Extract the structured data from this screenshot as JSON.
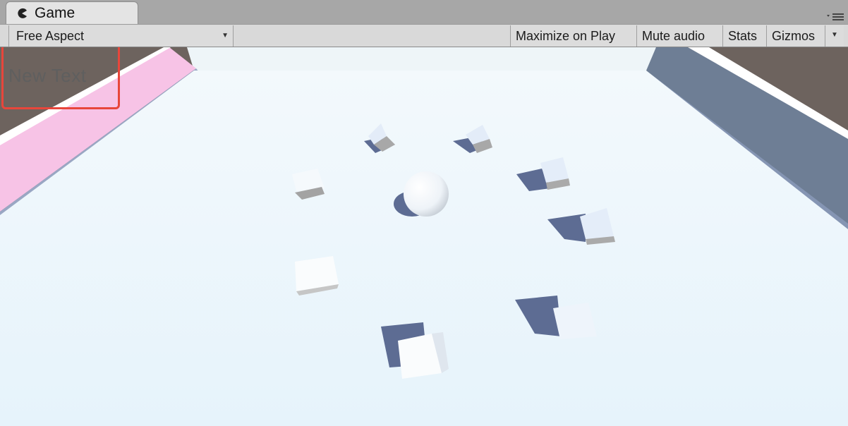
{
  "tab": {
    "title": "Game"
  },
  "toolbar": {
    "aspect_label": "Free Aspect",
    "maximize_label": "Maximize on Play",
    "mute_label": "Mute audio",
    "stats_label": "Stats",
    "gizmos_label": "Gizmos"
  },
  "scene": {
    "ui_text": "New Text",
    "colors": {
      "floor": "#eef6fb",
      "left_wall": "#f7c3e6",
      "right_wall": "#6e7e95",
      "background": "#6d635e",
      "highlight": "#e8463b"
    }
  }
}
